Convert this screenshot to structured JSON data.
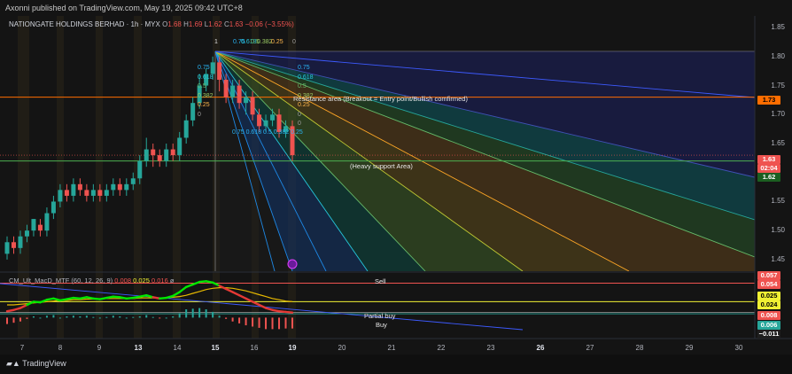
{
  "header": {
    "published_text": "Axonni published on TradingView.com, May 19, 2025 09:42 UTC+8"
  },
  "legend": {
    "symbol": "NATIONGATE HOLDINGS BERHAD · 1h · MYX",
    "open_label": "O",
    "open": "1.68",
    "high_label": "H",
    "high": "1.69",
    "low_label": "L",
    "low": "1.62",
    "close_label": "C",
    "close": "1.63",
    "change": "−0.06 (−3.55%)"
  },
  "macd_legend": {
    "name": "CM_Ult_MacD_MTF (60, 12, 26, 9)",
    "val1": "0.008",
    "val2": "0.025",
    "val3": "0.016"
  },
  "price_axis": [
    "1.85",
    "1.80",
    "1.75",
    "1.70",
    "1.65",
    "1.55",
    "1.50",
    "1.45"
  ],
  "price_tags": {
    "resistance": "1.73",
    "close": "1.63",
    "countdown": "02:04",
    "support": "1.62"
  },
  "macd_tags": [
    "0.057",
    "0.054",
    "0.025",
    "0.024",
    "0.008",
    "0.006",
    "−0.011"
  ],
  "x_axis": [
    "7",
    "8",
    "9",
    "13",
    "14",
    "15",
    "16",
    "19",
    "20",
    "21",
    "22",
    "23",
    "26",
    "27",
    "28",
    "29",
    "30"
  ],
  "annotations": {
    "resistance": "Resistance area (Breakout = Entry point/Bullish comfirmed)",
    "support": "(Heavy support Area)",
    "sell": "Sell",
    "partial_buy": "Partial buy",
    "buy": "Buy"
  },
  "fib_labels": {
    "top_row": "0.75",
    "top_row2": "0.618",
    "top_row3": "0.5",
    "top_row4": "0.382",
    "top_row5": "0.25",
    "top_zero": "0",
    "one": "1",
    "left_col": [
      "0.75",
      "0.618",
      "0.5",
      "0.382",
      "0.25",
      "0"
    ],
    "right_col": [
      "0.75",
      "0.618",
      "0.5",
      "0.382",
      "0.25",
      "0"
    ],
    "bottom_row": "0.75 0.618 0.5 0.382 0.25",
    "bottom_zero": "0"
  },
  "footer": {
    "brand": "TradingView"
  },
  "colors": {
    "bull": "#26a69a",
    "bear": "#ef5350",
    "resistance": "#ff6d00",
    "support": "#4caf50",
    "macd_line": "#00e600",
    "signal": "#e6b800"
  },
  "chart_data": {
    "type": "candlestick",
    "title": "NATIONGATE HOLDINGS BERHAD · 1h · MYX",
    "ylim": [
      1.43,
      1.87
    ],
    "price_levels": {
      "resistance": 1.73,
      "support": 1.62,
      "last_close": 1.63
    },
    "candles": [
      {
        "o": 1.46,
        "c": 1.48,
        "h": 1.49,
        "l": 1.45
      },
      {
        "o": 1.48,
        "c": 1.47,
        "h": 1.49,
        "l": 1.46
      },
      {
        "o": 1.47,
        "c": 1.49,
        "h": 1.5,
        "l": 1.46
      },
      {
        "o": 1.49,
        "c": 1.5,
        "h": 1.51,
        "l": 1.48
      },
      {
        "o": 1.5,
        "c": 1.52,
        "h": 1.52,
        "l": 1.49
      },
      {
        "o": 1.51,
        "c": 1.5,
        "h": 1.52,
        "l": 1.49
      },
      {
        "o": 1.5,
        "c": 1.53,
        "h": 1.54,
        "l": 1.49
      },
      {
        "o": 1.53,
        "c": 1.55,
        "h": 1.56,
        "l": 1.52
      },
      {
        "o": 1.55,
        "c": 1.57,
        "h": 1.58,
        "l": 1.54
      },
      {
        "o": 1.57,
        "c": 1.56,
        "h": 1.58,
        "l": 1.55
      },
      {
        "o": 1.56,
        "c": 1.58,
        "h": 1.59,
        "l": 1.55
      },
      {
        "o": 1.58,
        "c": 1.57,
        "h": 1.59,
        "l": 1.56
      },
      {
        "o": 1.57,
        "c": 1.56,
        "h": 1.58,
        "l": 1.55
      },
      {
        "o": 1.56,
        "c": 1.57,
        "h": 1.58,
        "l": 1.55
      },
      {
        "o": 1.57,
        "c": 1.56,
        "h": 1.58,
        "l": 1.55
      },
      {
        "o": 1.56,
        "c": 1.57,
        "h": 1.58,
        "l": 1.55
      },
      {
        "o": 1.57,
        "c": 1.58,
        "h": 1.59,
        "l": 1.56
      },
      {
        "o": 1.58,
        "c": 1.57,
        "h": 1.59,
        "l": 1.56
      },
      {
        "o": 1.57,
        "c": 1.58,
        "h": 1.59,
        "l": 1.56
      },
      {
        "o": 1.58,
        "c": 1.59,
        "h": 1.6,
        "l": 1.57
      },
      {
        "o": 1.59,
        "c": 1.62,
        "h": 1.63,
        "l": 1.58
      },
      {
        "o": 1.62,
        "c": 1.64,
        "h": 1.66,
        "l": 1.61
      },
      {
        "o": 1.64,
        "c": 1.63,
        "h": 1.65,
        "l": 1.61
      },
      {
        "o": 1.63,
        "c": 1.62,
        "h": 1.64,
        "l": 1.61
      },
      {
        "o": 1.62,
        "c": 1.64,
        "h": 1.65,
        "l": 1.61
      },
      {
        "o": 1.64,
        "c": 1.63,
        "h": 1.65,
        "l": 1.62
      },
      {
        "o": 1.63,
        "c": 1.66,
        "h": 1.67,
        "l": 1.62
      },
      {
        "o": 1.66,
        "c": 1.69,
        "h": 1.7,
        "l": 1.65
      },
      {
        "o": 1.69,
        "c": 1.72,
        "h": 1.73,
        "l": 1.68
      },
      {
        "o": 1.72,
        "c": 1.75,
        "h": 1.77,
        "l": 1.71
      },
      {
        "o": 1.75,
        "c": 1.77,
        "h": 1.78,
        "l": 1.74
      },
      {
        "o": 1.77,
        "c": 1.79,
        "h": 1.8,
        "l": 1.76
      },
      {
        "o": 1.79,
        "c": 1.76,
        "h": 1.8,
        "l": 1.74
      },
      {
        "o": 1.76,
        "c": 1.73,
        "h": 1.77,
        "l": 1.72
      },
      {
        "o": 1.73,
        "c": 1.75,
        "h": 1.76,
        "l": 1.72
      },
      {
        "o": 1.75,
        "c": 1.72,
        "h": 1.76,
        "l": 1.71
      },
      {
        "o": 1.72,
        "c": 1.73,
        "h": 1.74,
        "l": 1.7
      },
      {
        "o": 1.73,
        "c": 1.7,
        "h": 1.74,
        "l": 1.69
      },
      {
        "o": 1.7,
        "c": 1.68,
        "h": 1.71,
        "l": 1.67
      },
      {
        "o": 1.68,
        "c": 1.69,
        "h": 1.7,
        "l": 1.67
      },
      {
        "o": 1.69,
        "c": 1.7,
        "h": 1.71,
        "l": 1.68
      },
      {
        "o": 1.7,
        "c": 1.67,
        "h": 1.71,
        "l": 1.66
      },
      {
        "o": 1.67,
        "c": 1.68,
        "h": 1.69,
        "l": 1.66
      },
      {
        "o": 1.68,
        "c": 1.63,
        "h": 1.69,
        "l": 1.62
      }
    ],
    "macd": {
      "ylim": [
        -0.03,
        0.07
      ],
      "macd_line": [
        0.01,
        0.012,
        0.015,
        0.02,
        0.025,
        0.024,
        0.028,
        0.03,
        0.027,
        0.029,
        0.031,
        0.03,
        0.032,
        0.03,
        0.029,
        0.031,
        0.033,
        0.032,
        0.03,
        0.031,
        0.033,
        0.035,
        0.032,
        0.03,
        0.031,
        0.034,
        0.04,
        0.048,
        0.052,
        0.056,
        0.057,
        0.055,
        0.05,
        0.045,
        0.04,
        0.035,
        0.03,
        0.025,
        0.02,
        0.015,
        0.012,
        0.01,
        0.009,
        0.008
      ],
      "signal_line": [
        0.02,
        0.02,
        0.021,
        0.022,
        0.023,
        0.024,
        0.025,
        0.026,
        0.027,
        0.027,
        0.028,
        0.028,
        0.029,
        0.029,
        0.029,
        0.03,
        0.03,
        0.03,
        0.03,
        0.03,
        0.031,
        0.031,
        0.031,
        0.031,
        0.031,
        0.032,
        0.033,
        0.035,
        0.038,
        0.041,
        0.044,
        0.046,
        0.047,
        0.047,
        0.046,
        0.044,
        0.042,
        0.039,
        0.036,
        0.033,
        0.03,
        0.028,
        0.026,
        0.025
      ],
      "histogram": [
        -0.01,
        -0.008,
        -0.006,
        -0.002,
        0.002,
        0.0,
        0.003,
        0.004,
        0.0,
        0.002,
        0.003,
        0.002,
        0.003,
        0.001,
        0.0,
        0.001,
        0.003,
        0.002,
        0.0,
        0.001,
        0.002,
        0.004,
        0.001,
        -0.001,
        0.0,
        0.002,
        0.007,
        0.013,
        0.014,
        0.015,
        0.013,
        0.009,
        0.003,
        -0.002,
        -0.006,
        -0.009,
        -0.012,
        -0.014,
        -0.016,
        -0.018,
        -0.018,
        -0.018,
        -0.017,
        -0.017
      ],
      "levels": {
        "sell": 0.054,
        "upper": 0.025,
        "mid": 0.024,
        "partial_buy": 0.008,
        "buy": 0.006
      }
    }
  }
}
